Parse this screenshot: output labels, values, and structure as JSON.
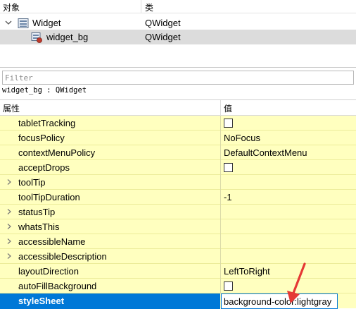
{
  "object_inspector": {
    "header": {
      "object_col": "对象",
      "class_col": "类"
    },
    "rows": [
      {
        "name": "Widget",
        "class": "QWidget"
      },
      {
        "name": "widget_bg",
        "class": "QWidget"
      }
    ]
  },
  "filter": {
    "placeholder": "Filter"
  },
  "class_label": "widget_bg : QWidget",
  "property_editor": {
    "header": {
      "property_col": "属性",
      "value_col": "值"
    },
    "rows": [
      {
        "name": "tabletTracking",
        "value": "",
        "checkbox": true
      },
      {
        "name": "focusPolicy",
        "value": "NoFocus"
      },
      {
        "name": "contextMenuPolicy",
        "value": "DefaultContextMenu"
      },
      {
        "name": "acceptDrops",
        "value": "",
        "checkbox": true
      },
      {
        "name": "toolTip",
        "value": "",
        "expandable": true
      },
      {
        "name": "toolTipDuration",
        "value": "-1"
      },
      {
        "name": "statusTip",
        "value": "",
        "expandable": true
      },
      {
        "name": "whatsThis",
        "value": "",
        "expandable": true
      },
      {
        "name": "accessibleName",
        "value": "",
        "expandable": true
      },
      {
        "name": "accessibleDescription",
        "value": "",
        "expandable": true
      },
      {
        "name": "layoutDirection",
        "value": "LeftToRight"
      },
      {
        "name": "autoFillBackground",
        "value": "",
        "checkbox": true
      },
      {
        "name": "styleSheet",
        "value": "background-color:lightgray",
        "selected": true
      }
    ]
  },
  "colors": {
    "selection": "#0078d7",
    "property_bg": "#ffffbf",
    "tree_selection": "#dcdcdc",
    "annotation_arrow": "#e53935"
  }
}
